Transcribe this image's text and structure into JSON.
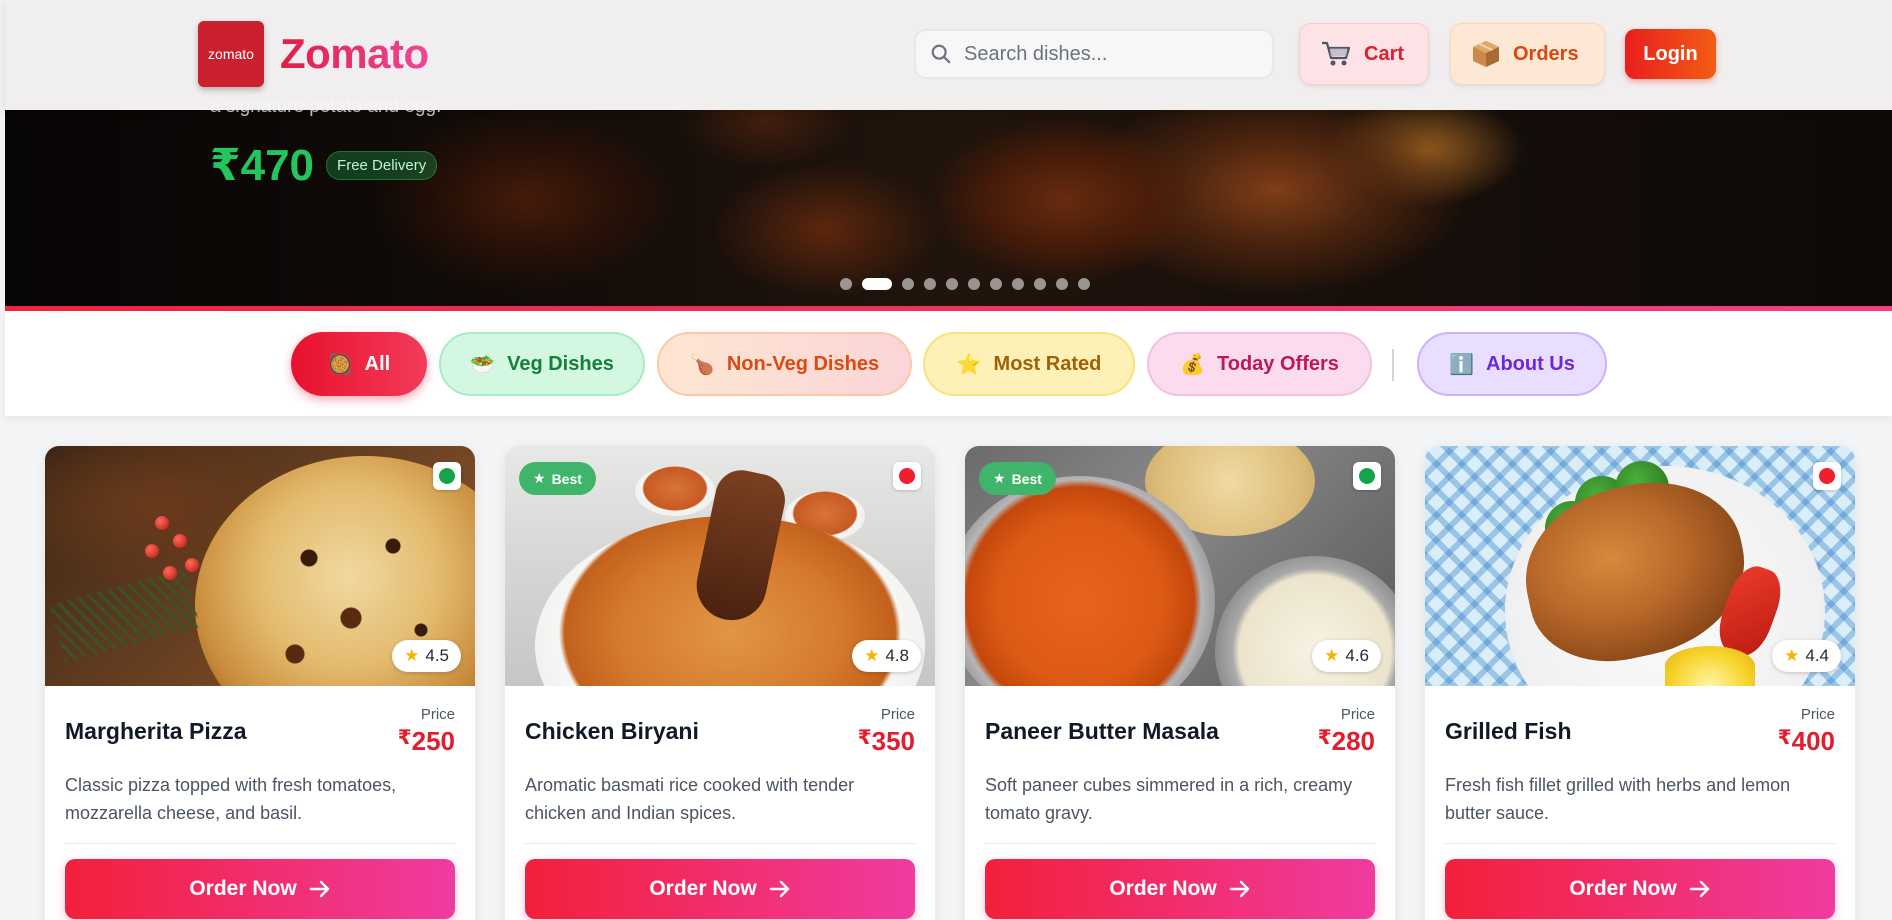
{
  "header": {
    "logo_text": "zomato",
    "brand": "Zomato",
    "search_placeholder": "Search dishes...",
    "cart_label": "Cart",
    "orders_label": "Orders",
    "login_label": "Login"
  },
  "hero": {
    "caption": "a signature potato and egg.",
    "price": "₹470",
    "badge": "Free Delivery",
    "slides_total": 11,
    "active_slide": 2
  },
  "filters": {
    "all": "All",
    "veg": "Veg Dishes",
    "nonveg": "Non-Veg Dishes",
    "rated": "Most Rated",
    "offers": "Today Offers",
    "about": "About Us"
  },
  "price_label": "Price",
  "order_label": "Order Now",
  "dishes": [
    {
      "name": "Margherita Pizza",
      "price": "250",
      "rating": "4.5",
      "veg": true,
      "best": false,
      "description": "Classic pizza topped with fresh tomatoes, mozzarella cheese, and basil."
    },
    {
      "name": "Chicken Biryani",
      "price": "350",
      "rating": "4.8",
      "veg": false,
      "best": true,
      "best_label": "Best",
      "description": "Aromatic basmati rice cooked with tender chicken and Indian spices."
    },
    {
      "name": "Paneer Butter Masala",
      "price": "280",
      "rating": "4.6",
      "veg": true,
      "best": true,
      "best_label": "Best",
      "description": "Soft paneer cubes simmered in a rich, creamy tomato gravy."
    },
    {
      "name": "Grilled Fish",
      "price": "400",
      "rating": "4.4",
      "veg": false,
      "best": false,
      "description": "Fresh fish fillet grilled with herbs and lemon butter sauce."
    }
  ],
  "colors": {
    "veg": "#16a34a",
    "nonveg": "#ef1f2f",
    "accent": "#e11d2e"
  }
}
